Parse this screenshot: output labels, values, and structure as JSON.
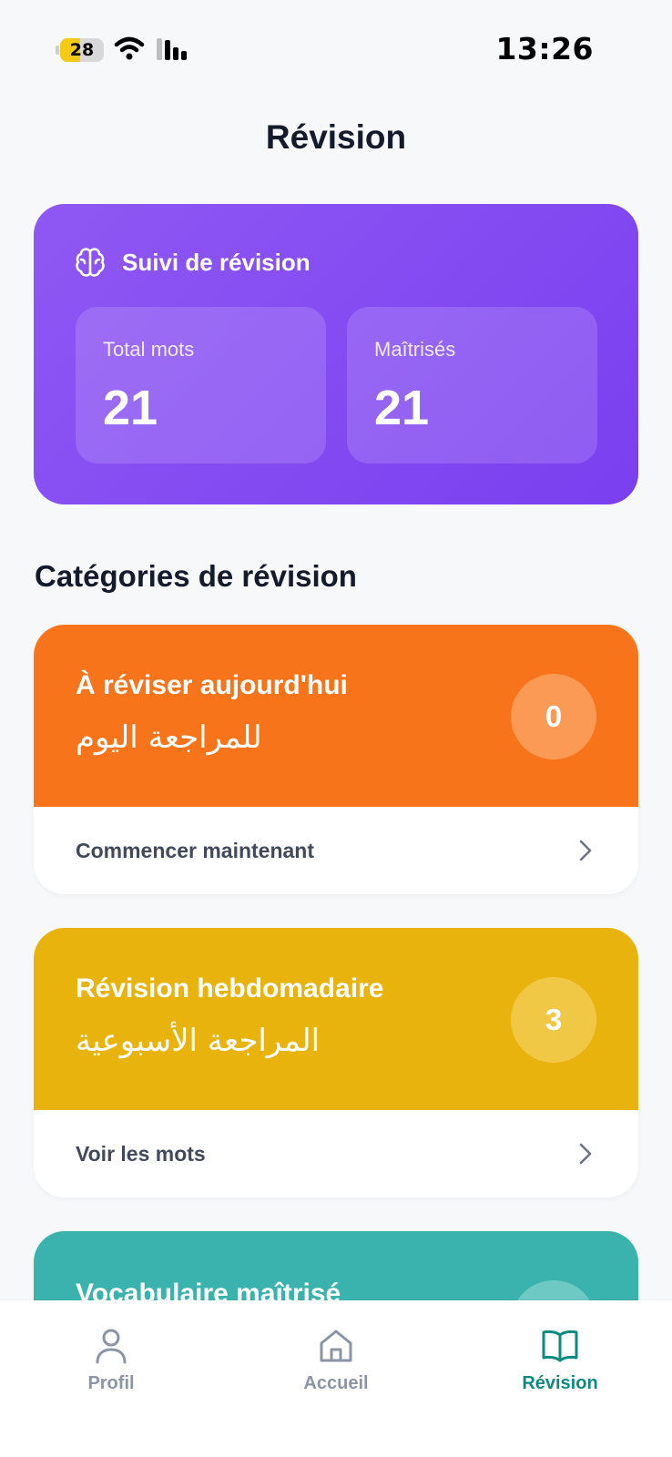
{
  "status_bar": {
    "battery": "28",
    "time": "13:26"
  },
  "page": {
    "title": "Révision"
  },
  "tracking": {
    "title": "Suivi de révision",
    "stats": [
      {
        "label": "Total mots",
        "value": "21"
      },
      {
        "label": "Maîtrisés",
        "value": "21"
      }
    ]
  },
  "section": {
    "title": "Catégories de révision"
  },
  "categories": [
    {
      "title_fr": "À réviser aujourd'hui",
      "title_ar": "للمراجعة اليوم",
      "count": "0",
      "action": "Commencer maintenant",
      "color": "#f8741a"
    },
    {
      "title_fr": "Révision hebdomadaire",
      "title_ar": "المراجعة الأسبوعية",
      "count": "3",
      "action": "Voir les mots",
      "color": "#e8b30c"
    },
    {
      "title_fr": "Vocabulaire maîtrisé",
      "color": "#3ab3ae"
    }
  ],
  "nav": {
    "items": [
      {
        "label": "Profil",
        "icon": "person-icon"
      },
      {
        "label": "Accueil",
        "icon": "home-icon"
      },
      {
        "label": "Révision",
        "icon": "book-icon",
        "active": true
      }
    ],
    "active_color": "#0d8a80"
  },
  "colors": {
    "tracker": "#8350f2",
    "background": "#f7f8fa"
  }
}
